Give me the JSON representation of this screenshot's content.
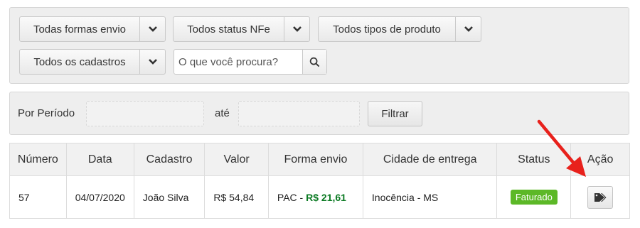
{
  "filters": {
    "shipping_method": "Todas formas envio",
    "nfe_status": "Todos status NFe",
    "product_type": "Todos tipos de produto",
    "registrations": "Todos os cadastros",
    "search_placeholder": "O que você procura?"
  },
  "period": {
    "label": "Por Período",
    "until_label": "até",
    "filter_button": "Filtrar"
  },
  "table": {
    "headers": [
      "Número",
      "Data",
      "Cadastro",
      "Valor",
      "Forma envio",
      "Cidade de entrega",
      "Status",
      "Ação"
    ],
    "rows": [
      {
        "number": "57",
        "date": "04/07/2020",
        "customer": "João Silva",
        "value": "R$ 54,84",
        "shipping_method": "PAC - ",
        "shipping_cost": "R$ 21,61",
        "city": "Inocência - MS",
        "status": "Faturado"
      }
    ]
  },
  "icons": {
    "caret": "chevron-down-icon",
    "search": "search-icon",
    "action": "tags-icon",
    "annotation": "red-arrow"
  },
  "colors": {
    "status_badge": "#5cb827",
    "shipping_cost": "#0b7a23",
    "arrow": "#e8211c"
  }
}
